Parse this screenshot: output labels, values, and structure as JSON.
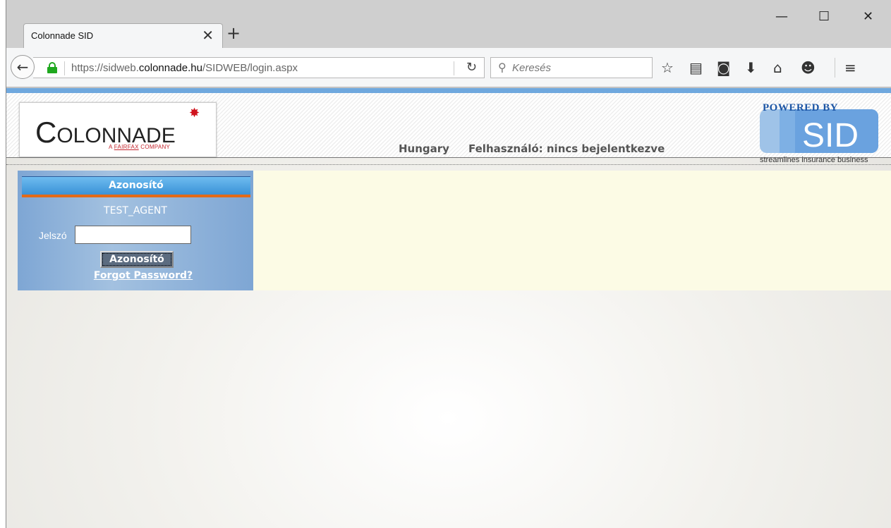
{
  "browser": {
    "tab_title": "Colonnade SID",
    "tab_close": "✕",
    "new_tab": "+",
    "url_prefix": "https://sidweb.",
    "url_domain": "colonnade.hu",
    "url_path": "/SIDWEB/login.aspx",
    "search_placeholder": "Keresés",
    "window_controls": {
      "minimize": "—",
      "maximize": "☐",
      "close": "✕"
    }
  },
  "header": {
    "logo_text_first": "C",
    "logo_text_rest": "OLONNADE",
    "logo_sub_a": "A ",
    "logo_sub_fairfax": "FAIRFAX",
    "logo_sub_company": " COMPANY",
    "country": "Hungary",
    "user_status": "Felhasználó: nincs bejelentkezve",
    "powered_by": "POWERED BY",
    "sid_word": "SID",
    "sid_tagline": "streamlines insurance business"
  },
  "login": {
    "title": "Azonosító",
    "username": "TEST_AGENT",
    "password_label": "Jelszó",
    "password_value": "",
    "submit_label": "Azonosító",
    "forgot_label": "Forgot Password?"
  },
  "colors": {
    "accent_blue": "#6fa8de",
    "login_header": "#3b92d6",
    "orange_bar": "#e36a17",
    "content_bg": "#fcfbe5"
  }
}
